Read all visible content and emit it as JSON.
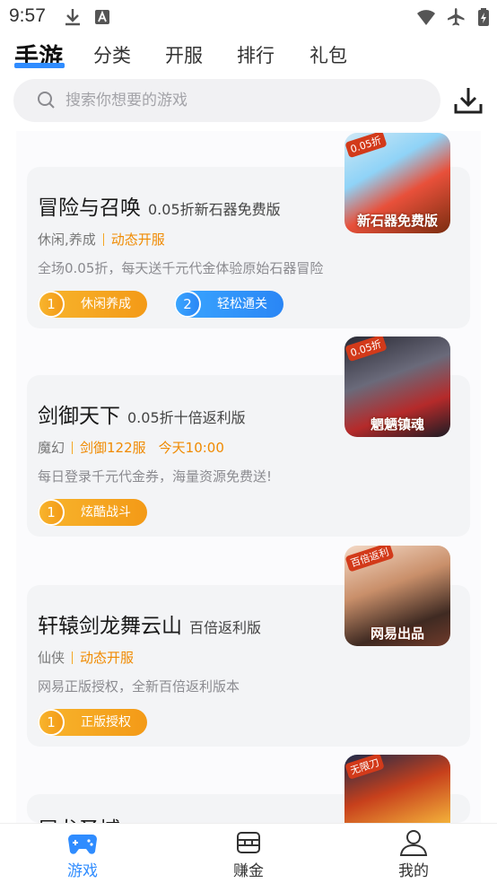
{
  "status": {
    "time": "9:57"
  },
  "nav": {
    "tabs": [
      {
        "label": "手游",
        "active": true
      },
      {
        "label": "分类"
      },
      {
        "label": "开服"
      },
      {
        "label": "排行"
      },
      {
        "label": "礼包"
      }
    ],
    "accent_color": "#2f8cff"
  },
  "search": {
    "placeholder": "搜索你想要的游戏"
  },
  "games": [
    {
      "title": "冒险与召唤",
      "subtitle": "0.05折新石器免费版",
      "tags": [
        "休闲,养成",
        "动态开服"
      ],
      "desc": "全场0.05折，每天送千元代金体验原始石器冒险",
      "thumb_badge": "0.05折",
      "thumb_caption": "新石器免费版",
      "pills": [
        {
          "num": "1",
          "label": "休闲养成",
          "color": "orange"
        },
        {
          "num": "2",
          "label": "轻松通关",
          "color": "blue"
        }
      ]
    },
    {
      "title": "剑御天下",
      "subtitle": "0.05折十倍返利版",
      "tags": [
        "魔幻",
        "剑御122服",
        "今天10:00"
      ],
      "desc": "每日登录千元代金券，海量资源免费送!",
      "thumb_badge": "0.05折",
      "thumb_caption": "魍魉镇魂",
      "pills": [
        {
          "num": "1",
          "label": "炫酷战斗",
          "color": "orange"
        }
      ]
    },
    {
      "title": "轩辕剑龙舞云山",
      "subtitle": "百倍返利版",
      "tags": [
        "仙侠",
        "动态开服"
      ],
      "desc": "网易正版授权，全新百倍返利版本",
      "thumb_badge": "百倍返利",
      "thumb_caption": "网易出品",
      "pills": [
        {
          "num": "1",
          "label": "正版授权",
          "color": "orange"
        }
      ]
    },
    {
      "title": "屠龙圣域",
      "thumb_badge": "无限刀"
    }
  ],
  "bottom_nav": [
    {
      "label": "游戏",
      "icon": "gamepad-icon",
      "active": true
    },
    {
      "label": "赚金",
      "icon": "coin-box-icon"
    },
    {
      "label": "我的",
      "icon": "user-icon"
    }
  ]
}
